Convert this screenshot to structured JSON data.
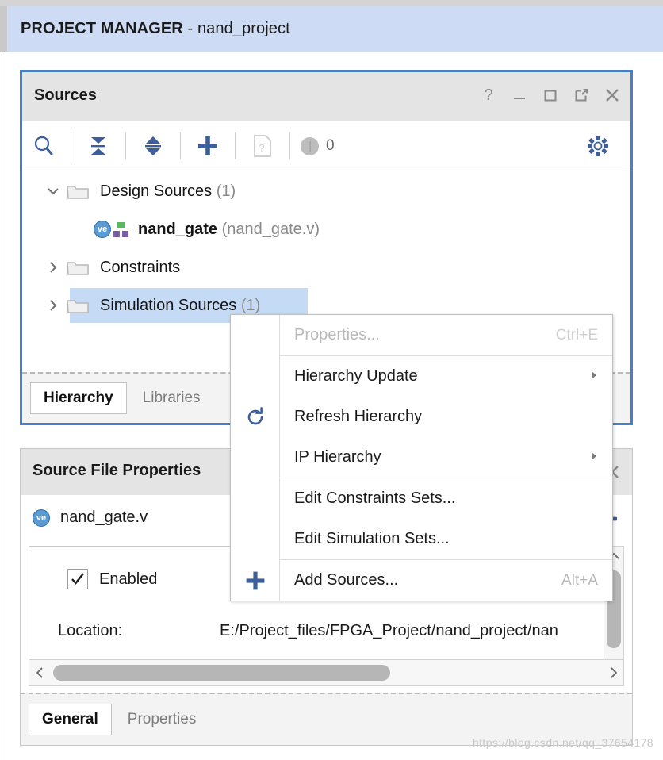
{
  "header": {
    "title_bold": "PROJECT MANAGER",
    "title_sep": " - ",
    "title_project": "nand_project"
  },
  "sources_panel": {
    "title": "Sources",
    "window_buttons": [
      {
        "name": "help-icon",
        "glyph": "?"
      },
      {
        "name": "minimize-icon",
        "glyph": "_"
      },
      {
        "name": "maximize-icon",
        "glyph": "□"
      },
      {
        "name": "float-icon",
        "glyph": "⇱"
      },
      {
        "name": "close-icon",
        "glyph": "✕"
      }
    ],
    "toolbar": {
      "search_icon": "search-icon",
      "collapse_icon": "collapse-all-icon",
      "expand_icon": "expand-all-icon",
      "add_icon": "add-sources-icon",
      "report_icon": "report-icon",
      "warning_count": "0",
      "settings_icon": "gear-icon"
    },
    "tree": [
      {
        "label": "Design Sources",
        "count": "(1)",
        "expanded": true,
        "selected": false,
        "children": [
          {
            "name": "nand_gate",
            "file": "(nand_gate.v)",
            "badge": "ve"
          }
        ]
      },
      {
        "label": "Constraints",
        "count": "",
        "expanded": false,
        "selected": false,
        "children": []
      },
      {
        "label": "Simulation Sources",
        "count": "(1)",
        "expanded": false,
        "selected": true,
        "children": []
      }
    ],
    "tabs": [
      {
        "label": "Hierarchy",
        "active": true
      },
      {
        "label": "Libraries",
        "active": false
      }
    ]
  },
  "context_menu": {
    "items": [
      {
        "label": "Properties...",
        "accel": "Ctrl+E",
        "disabled": true,
        "submenu": false,
        "icon": ""
      },
      {
        "separator": true
      },
      {
        "label": "Hierarchy Update",
        "accel": "",
        "disabled": false,
        "submenu": true,
        "icon": ""
      },
      {
        "label": "Refresh Hierarchy",
        "accel": "",
        "disabled": false,
        "submenu": false,
        "icon": "refresh-icon"
      },
      {
        "label": "IP Hierarchy",
        "accel": "",
        "disabled": false,
        "submenu": true,
        "icon": ""
      },
      {
        "separator": true
      },
      {
        "label": "Edit Constraints Sets...",
        "accel": "",
        "disabled": false,
        "submenu": false,
        "icon": ""
      },
      {
        "label": "Edit Simulation Sets...",
        "accel": "",
        "disabled": false,
        "submenu": false,
        "icon": ""
      },
      {
        "separator": true
      },
      {
        "label": "Add Sources...",
        "accel": "Alt+A",
        "disabled": false,
        "submenu": false,
        "icon": "plus-icon"
      }
    ]
  },
  "source_file_properties": {
    "title": "Source File Properties",
    "close_glyph": "✕",
    "file_name": "nand_gate.v",
    "file_badge": "ve",
    "enabled_label": "Enabled",
    "enabled_checked": true,
    "location_label": "Location:",
    "location_value": "E:/Project_files/FPGA_Project/nand_project/nan",
    "tabs": [
      {
        "label": "General",
        "active": true
      },
      {
        "label": "Properties",
        "active": false
      }
    ]
  },
  "watermark": "https://blog.csdn.net/qq_37654178"
}
